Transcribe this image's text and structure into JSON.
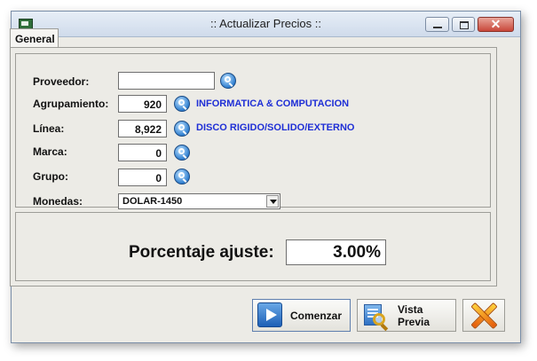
{
  "window": {
    "title": ":: Actualizar Precios ::"
  },
  "tabs": [
    {
      "label": "General"
    }
  ],
  "form": {
    "proveedor": {
      "label": "Proveedor:",
      "value": ""
    },
    "agrupamiento": {
      "label": "Agrupamiento:",
      "value": "920",
      "description": "INFORMATICA & COMPUTACION"
    },
    "linea": {
      "label": "Línea:",
      "value": "8,922",
      "description": "DISCO RIGIDO/SOLIDO/EXTERNO"
    },
    "marca": {
      "label": "Marca:",
      "value": "0"
    },
    "grupo": {
      "label": "Grupo:",
      "value": "0"
    },
    "monedas": {
      "label": "Monedas:",
      "selected": "DOLAR-1450"
    }
  },
  "adjustment": {
    "label": "Porcentaje ajuste:",
    "value": "3.00%"
  },
  "buttons": {
    "start": "Comenzar",
    "preview_line1": "Vista",
    "preview_line2": "Previa"
  },
  "colors": {
    "description_text": "#1f2fd6",
    "title_bar": "#cfdbeb",
    "close_button": "#c8473a"
  }
}
